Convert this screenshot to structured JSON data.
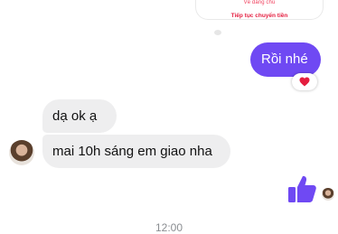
{
  "product_card": {
    "button_label": "Về đáng chú"
  },
  "continue_link": "Tiếp tục chuyển tiền",
  "messages": {
    "outgoing_1": "Rồi nhé",
    "incoming_1": "dạ ok ạ",
    "incoming_2": "mai 10h sáng em giao nha"
  },
  "reaction": {
    "icon": "heart-icon",
    "color": "#e41e3f"
  },
  "like": {
    "icon": "thumbs-up-icon",
    "color": "#6f49f3"
  },
  "timestamp": "12:00",
  "colors": {
    "outgoing_bubble": "#6f49f3",
    "incoming_bubble": "#eeeeef"
  }
}
